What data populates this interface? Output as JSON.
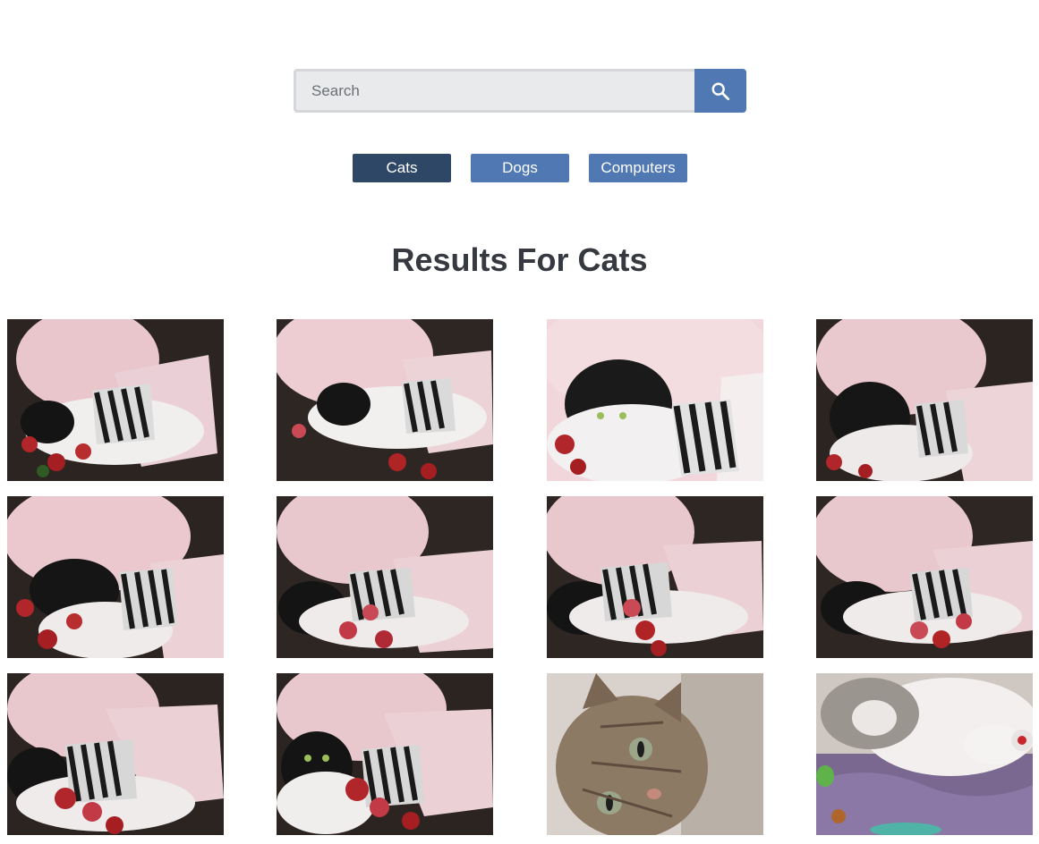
{
  "search": {
    "placeholder": "Search",
    "icon": "search-icon"
  },
  "categories": [
    {
      "label": "Cats",
      "active": true
    },
    {
      "label": "Dogs",
      "active": false
    },
    {
      "label": "Computers",
      "active": false
    }
  ],
  "results": {
    "heading": "Results For Cats"
  },
  "colors": {
    "accent": "#5079b3",
    "active": "#2e4766",
    "heading": "#363a40"
  }
}
